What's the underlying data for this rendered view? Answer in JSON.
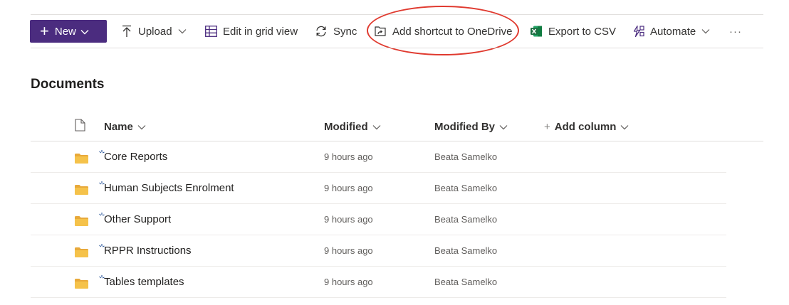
{
  "toolbar": {
    "new_label": "New",
    "upload_label": "Upload",
    "edit_grid_label": "Edit in grid view",
    "sync_label": "Sync",
    "add_shortcut_label": "Add shortcut to OneDrive",
    "export_csv_label": "Export to CSV",
    "automate_label": "Automate",
    "more_label": "···"
  },
  "icons": {
    "new": "plus-icon",
    "upload": "upload-arrow-icon",
    "edit_grid": "grid-table-icon",
    "sync": "sync-icon",
    "add_shortcut": "cloud-shortcut-icon",
    "export_csv": "excel-icon",
    "automate": "power-automate-icon",
    "file_type": "document-icon",
    "folder": "folder-icon",
    "new_item": "new-item-sparkle-icon"
  },
  "colors": {
    "new_button": "#4b2c7f",
    "highlight_circle": "#e03a2f",
    "folder": "#f5c24a",
    "excel": "#1d6f42"
  },
  "page": {
    "title": "Documents"
  },
  "columns": {
    "name": "Name",
    "modified": "Modified",
    "modified_by": "Modified By",
    "add_column": "Add column",
    "add_column_plus": "+"
  },
  "rows": [
    {
      "name": "Core Reports",
      "modified": "9 hours ago",
      "modified_by": "Beata Samelko"
    },
    {
      "name": "Human Subjects Enrolment",
      "modified": "9 hours ago",
      "modified_by": "Beata Samelko"
    },
    {
      "name": "Other Support",
      "modified": "9 hours ago",
      "modified_by": "Beata Samelko"
    },
    {
      "name": "RPPR Instructions",
      "modified": "9 hours ago",
      "modified_by": "Beata Samelko"
    },
    {
      "name": "Tables templates",
      "modified": "9 hours ago",
      "modified_by": "Beata Samelko"
    }
  ]
}
